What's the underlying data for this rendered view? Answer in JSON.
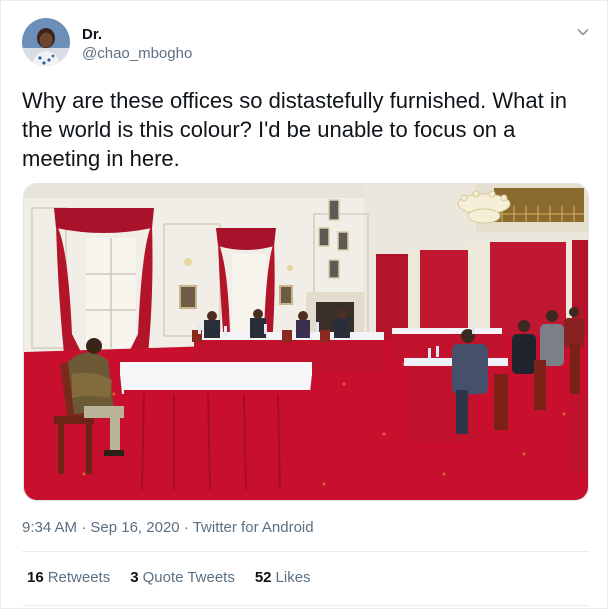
{
  "author": {
    "display_name": "Dr.",
    "handle": "@chao_mbogho"
  },
  "tweet": {
    "text": "Why are these offices so distastefully furnished. What in the world is this colour? I'd be unable to focus on a meeting in here."
  },
  "meta": {
    "time": "9:34 AM",
    "date": "Sep 16, 2020",
    "separator": "·",
    "source": "Twitter for Android"
  },
  "stats": {
    "retweets_count": "16",
    "retweets_label": "Retweets",
    "quotes_count": "3",
    "quotes_label": "Quote Tweets",
    "likes_count": "52",
    "likes_label": "Likes"
  },
  "colors": {
    "carpet": "#c8102e",
    "curtain": "#b3142a",
    "wall": "#f3f0ea",
    "secondary_text": "#5b7083"
  },
  "icons": {
    "menu": "chevron-down-icon"
  }
}
